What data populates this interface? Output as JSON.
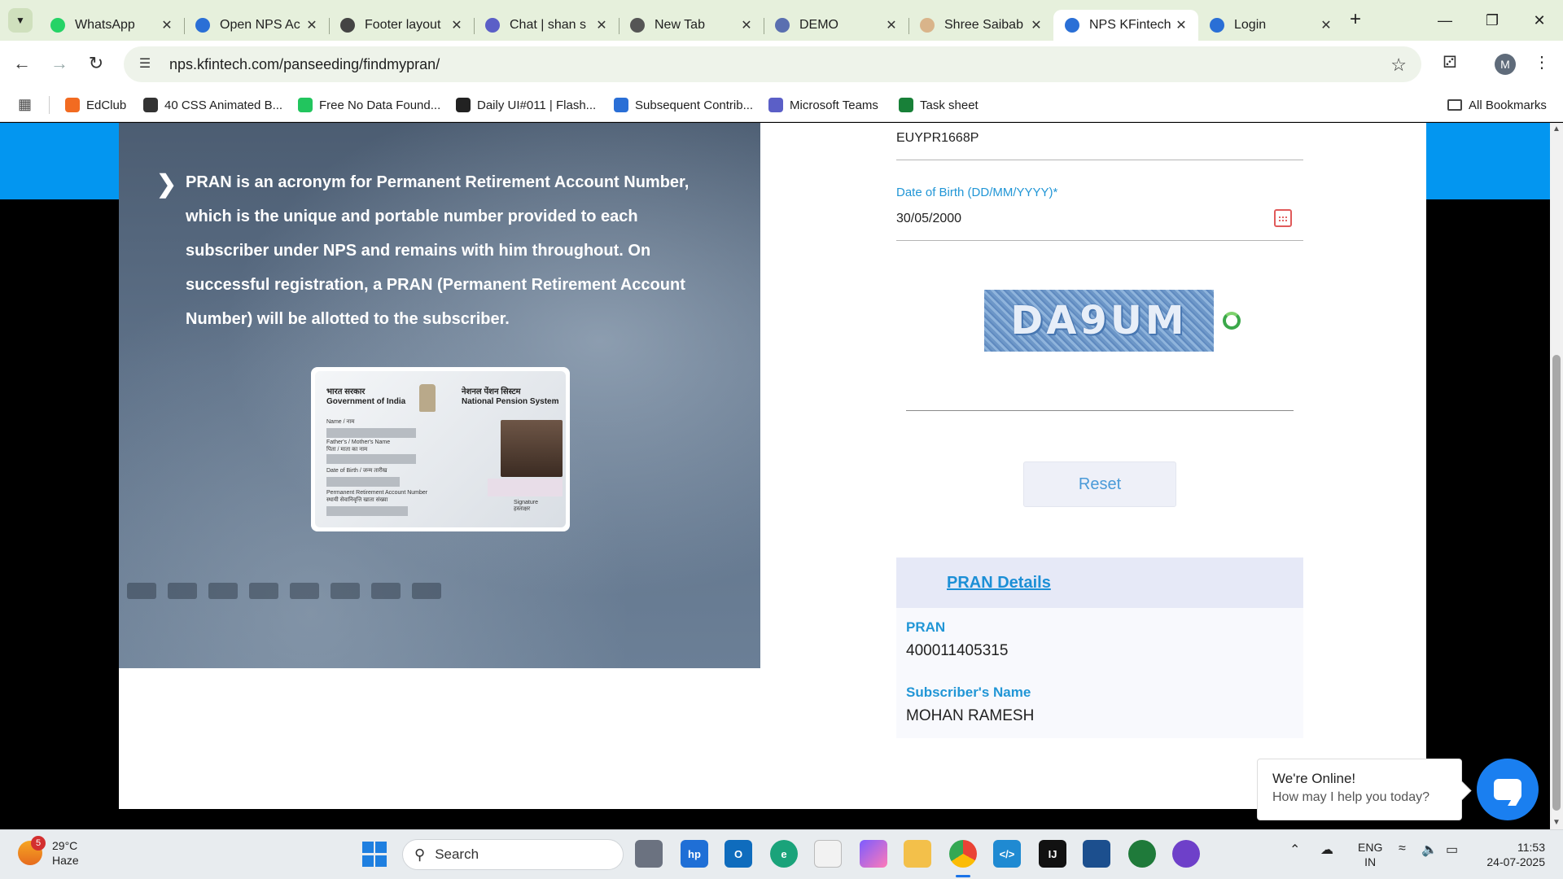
{
  "browser": {
    "tabs": [
      {
        "title": "WhatsApp",
        "icon": "whatsapp-icon",
        "color": "#25d366"
      },
      {
        "title": "Open NPS Ac",
        "icon": "nps-icon",
        "color": "#2a6fd6"
      },
      {
        "title": "Footer layout",
        "icon": "openai-icon",
        "color": "#444444"
      },
      {
        "title": "Chat | shan s",
        "icon": "teams-icon",
        "color": "#5b5fc7"
      },
      {
        "title": "New Tab",
        "icon": "chrome-icon",
        "color": "#555555"
      },
      {
        "title": "DEMO",
        "icon": "demo-icon",
        "color": "#5a6fb0"
      },
      {
        "title": "Shree Saibab",
        "icon": "saibaba-icon",
        "color": "#d9b48a"
      },
      {
        "title": "NPS KFintech",
        "icon": "nps-icon",
        "color": "#2a6fd6",
        "active": true
      },
      {
        "title": "Login",
        "icon": "nps-icon",
        "color": "#2a6fd6"
      }
    ],
    "url": "nps.kfintech.com/panseeding/findmypran/",
    "avatar_letter": "M",
    "bookmarks": [
      {
        "label": "EdClub",
        "color": "#f26b21"
      },
      {
        "label": "40 CSS Animated B...",
        "color": "#333333"
      },
      {
        "label": "Free No Data Found...",
        "color": "#22c55e"
      },
      {
        "label": "Daily UI#011 | Flash...",
        "color": "#222222"
      },
      {
        "label": "Subsequent Contrib...",
        "color": "#2a6fd6"
      },
      {
        "label": "Microsoft Teams",
        "color": "#5b5fc7"
      },
      {
        "label": "Task sheet",
        "color": "#188038"
      }
    ],
    "all_bookmarks": "All Bookmarks"
  },
  "page": {
    "hero_text": "PRAN is an acronym for Permanent Retirement Account Number, which is the unique and portable number provided to each subscriber under NPS and remains with him throughout. On successful registration, a PRAN (Permanent Retirement Account Number) will be allotted to the subscriber.",
    "card": {
      "gov_line1": "भारत सरकार",
      "gov_line2": "Government of India",
      "nps_line1": "नेशनल पेंशन सिस्टम",
      "nps_line2": "National Pension System",
      "name_label": "Name / नाम",
      "father_label": "Father's / Mother's Name",
      "father_label_hi": "पिता / माता का नाम",
      "dob_label": "Date of Birth / जन्म तारीख",
      "pran_label": "Permanent Retirement Account Number",
      "pran_label_hi": "स्थायी सेवानिवृत्ति खाता संख्या",
      "signature_label": "Signature",
      "signature_label_hi": "हस्ताक्षर"
    },
    "pan_value": "EUYPR1668P",
    "dob_label": "Date of Birth (DD/MM/YYYY)*",
    "dob_value": "30/05/2000",
    "captcha_text": "DA9UM",
    "reset_label": "Reset",
    "details": {
      "title": "PRAN Details",
      "pran_label": "PRAN",
      "pran_value": "400011405315",
      "name_label": "Subscriber's Name",
      "name_value": "MOHAN RAMESH"
    },
    "chat": {
      "online": "We're Online!",
      "sub": "How may I help you today?"
    }
  },
  "taskbar": {
    "weather_badge": "5",
    "temperature": "29°C",
    "condition": "Haze",
    "search_label": "Search",
    "lang_line1": "ENG",
    "lang_line2": "IN",
    "time": "11:53",
    "date": "24-07-2025"
  }
}
